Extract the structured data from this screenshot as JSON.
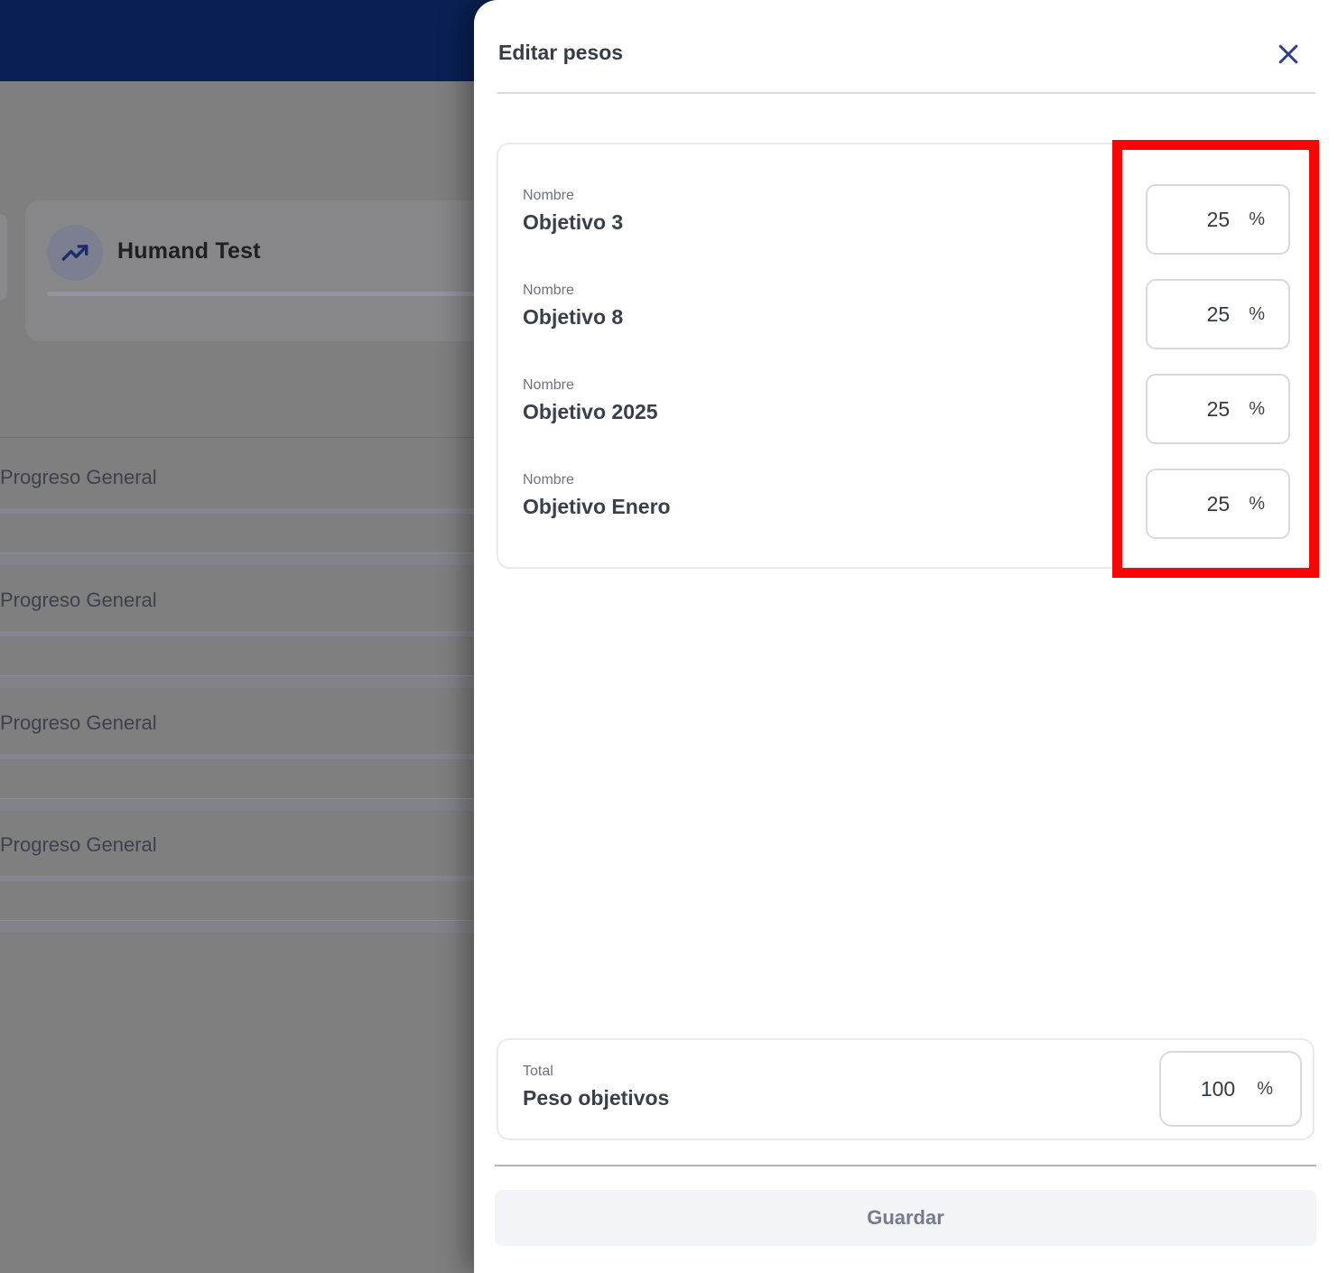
{
  "background": {
    "goal_card": {
      "title": "Humand Test",
      "icon": "trending-up-icon"
    },
    "rows": [
      {
        "label": "Progreso General"
      },
      {
        "label": "Progreso General"
      },
      {
        "label": "Progreso General"
      },
      {
        "label": "Progreso General"
      }
    ]
  },
  "drawer": {
    "title": "Editar pesos",
    "close_icon": "close-icon",
    "weights": [
      {
        "label": "Nombre",
        "name": "Objetivo 3",
        "value": "25",
        "unit": "%"
      },
      {
        "label": "Nombre",
        "name": "Objetivo 8",
        "value": "25",
        "unit": "%"
      },
      {
        "label": "Nombre",
        "name": "Objetivo 2025",
        "value": "25",
        "unit": "%"
      },
      {
        "label": "Nombre",
        "name": "Objetivo Enero",
        "value": "25",
        "unit": "%"
      }
    ],
    "total": {
      "label": "Total",
      "name": "Peso objetivos",
      "value": "100",
      "unit": "%"
    },
    "save_label": "Guardar"
  },
  "annotation": {
    "type": "red-highlight-rectangle"
  },
  "colors": {
    "navbar_navy": "#0a2055",
    "overlay_gray": "#7f7f80",
    "accent_navy": "#2b3c8a",
    "annotation_red": "#f90505",
    "save_bg": "#f3f4f8",
    "save_text": "#767a8c"
  }
}
